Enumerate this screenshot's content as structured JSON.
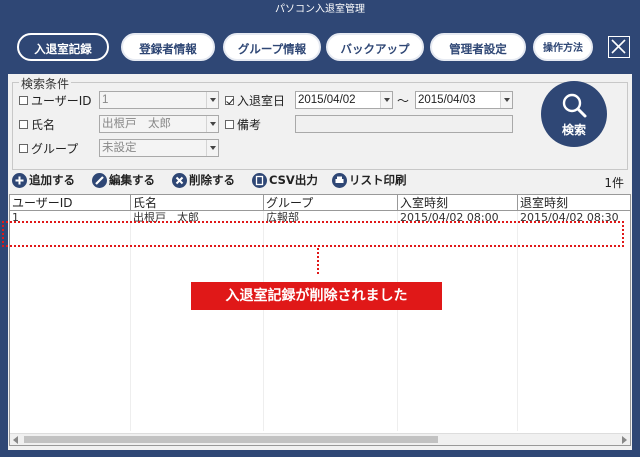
{
  "window": {
    "title": "パソコン入退室管理"
  },
  "toolbar": {
    "buttons": [
      {
        "label": "入退室記録",
        "active": true
      },
      {
        "label": "登録者情報"
      },
      {
        "label": "グループ情報"
      },
      {
        "label": "バックアップ"
      },
      {
        "label": "管理者設定"
      },
      {
        "label": "操作方法"
      }
    ]
  },
  "search": {
    "legend": "検索条件",
    "user_id": {
      "label": "ユーザーID",
      "checked": false,
      "value": "1"
    },
    "name": {
      "label": "氏名",
      "checked": false,
      "value": "出根戸　太郎"
    },
    "group": {
      "label": "グループ",
      "checked": false,
      "value": "未設定"
    },
    "entry_date": {
      "label": "入退室日",
      "checked": true,
      "from": "2015/04/02",
      "to": "2015/04/03",
      "separator": "～"
    },
    "note": {
      "label": "備考",
      "checked": false,
      "value": ""
    },
    "search_button": "検索"
  },
  "actions": {
    "add": "追加する",
    "edit": "編集する",
    "delete": "削除する",
    "csv": "CSV出力",
    "print": "リスト印刷"
  },
  "result_count": "1件",
  "grid": {
    "columns": [
      "ユーザーID",
      "氏名",
      "グループ",
      "入室時刻",
      "退室時刻"
    ],
    "rows": [
      [
        "1",
        "出根戸　太郎",
        "広報部",
        "2015/04/02 08:00",
        "2015/04/02 08:30"
      ]
    ]
  },
  "notice": "入退室記録が削除されました",
  "colors": {
    "brand": "#2f4775",
    "alert": "#e01818"
  }
}
